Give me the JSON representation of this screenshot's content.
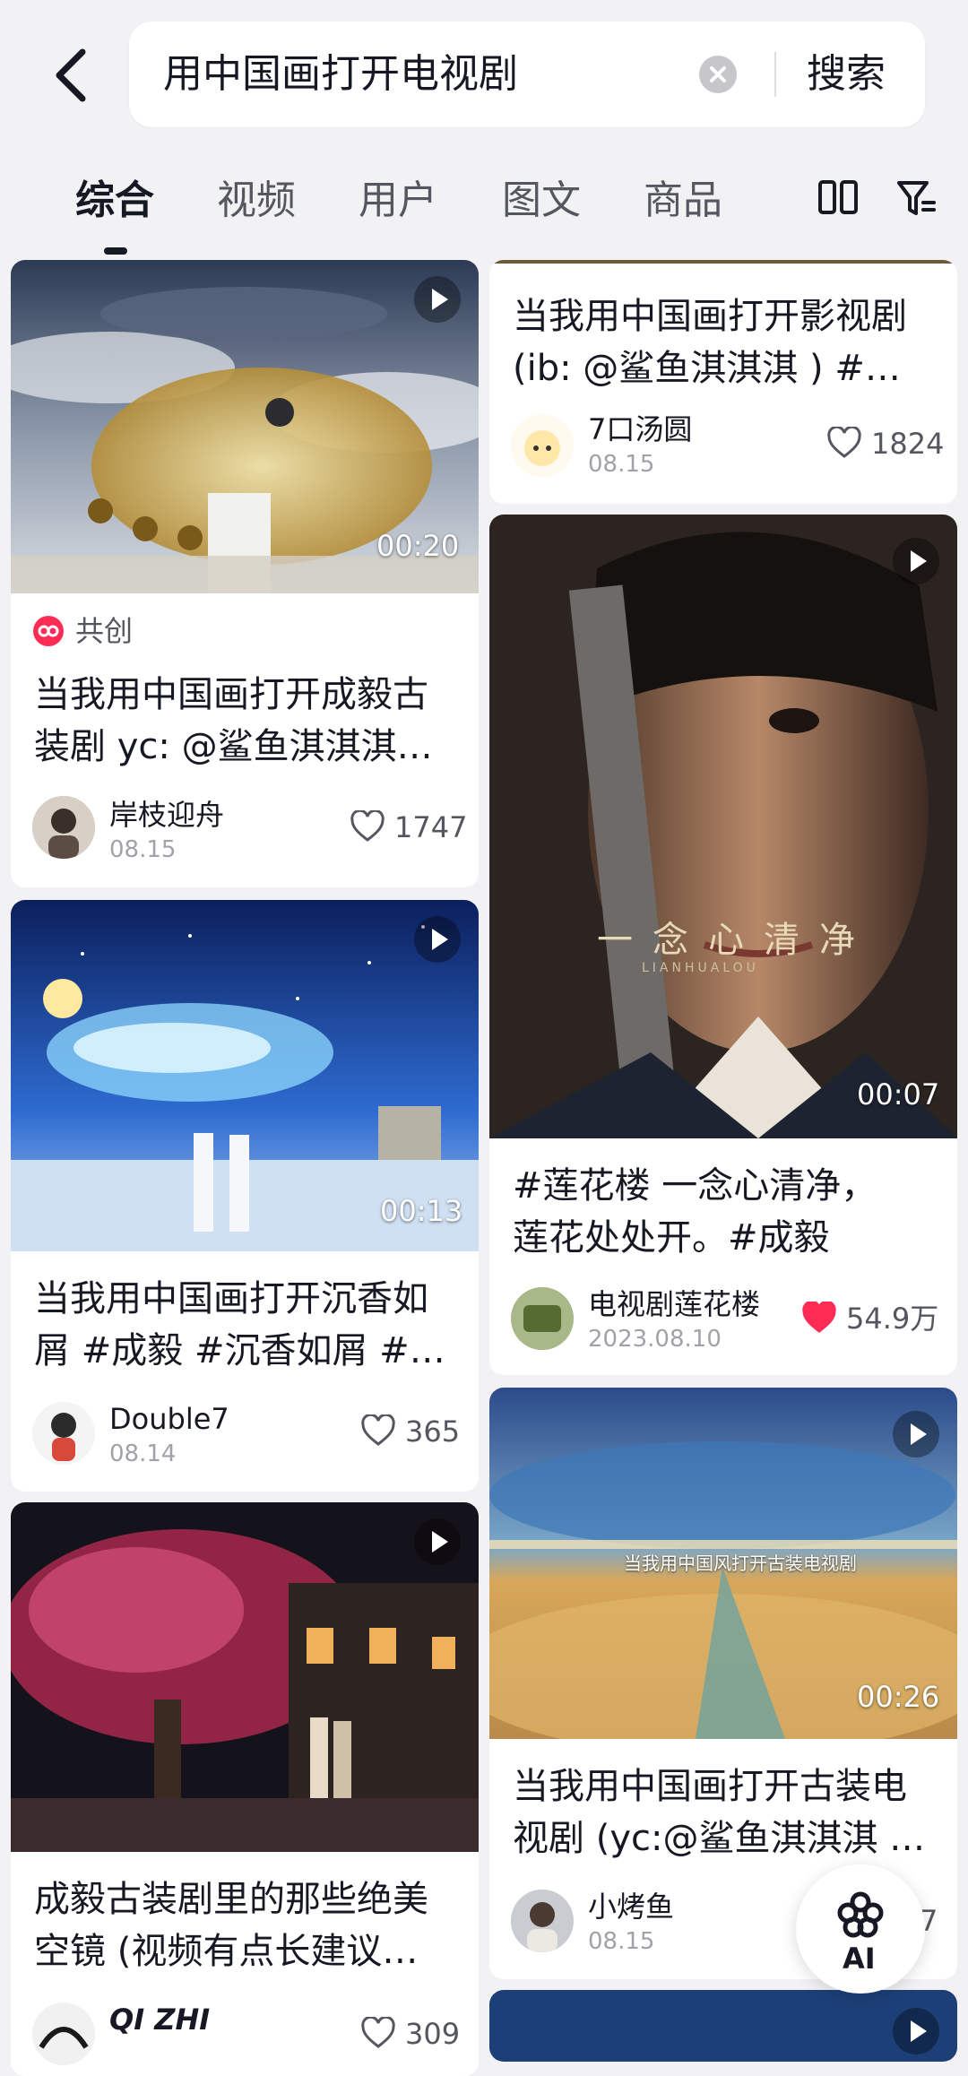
{
  "search": {
    "query": "用中国画打开电视剧",
    "button_label": "搜索"
  },
  "tabs": [
    {
      "label": "综合",
      "active": true
    },
    {
      "label": "视频",
      "active": false
    },
    {
      "label": "用户",
      "active": false
    },
    {
      "label": "图文",
      "active": false
    },
    {
      "label": "商品",
      "active": false
    }
  ],
  "toolbar_icons": [
    "layout-toggle-icon",
    "filter-icon"
  ],
  "cards": [
    {
      "column": "left",
      "tag": "共创",
      "duration": "00:20",
      "title_line1": "当我用中国画打开成毅古",
      "title_line2": "装剧  yc: @鲨鱼淇淇淇…",
      "author": "岸枝迎舟",
      "date": "08.15",
      "likes": "1747",
      "liked": false
    },
    {
      "column": "left",
      "duration": "00:13",
      "title_line1": "当我用中国画打开沉香如",
      "title_line2": "屑 #成毅 #沉香如屑 #…",
      "author": "Double7",
      "date": "08.14",
      "likes": "365",
      "liked": false
    },
    {
      "column": "left",
      "title_line1": "成毅古装剧里的那些绝美",
      "title_line2": "空镜 (视频有点长建议…",
      "author": "QI ZHI",
      "likes": "309",
      "liked": false
    },
    {
      "column": "right",
      "title_line1": "当我用中国画打开影视剧",
      "title_line2": "(ib: @鲨鱼淇淇淇 ) #…",
      "author": "7口汤圆",
      "date": "08.15",
      "likes": "1824",
      "liked": false
    },
    {
      "column": "right",
      "duration": "00:07",
      "overlay_text": "一念心清净",
      "overlay_sub": "LIANHUALOU",
      "title_line1": "#莲花楼   一念心清净，",
      "title_line2": "莲花处处开。#成毅",
      "author": "电视剧莲花楼",
      "date": "2023.08.10",
      "likes": "54.9万",
      "liked": true
    },
    {
      "column": "right",
      "duration": "00:26",
      "overlay_text": "当我用中国风打开古装电视剧",
      "title_line1": "当我用中国画打开古装电",
      "title_line2": "视剧 (yc:@鲨鱼淇淇淇 …",
      "author": "小烤鱼",
      "date": "08.15",
      "likes": "7",
      "liked": false
    }
  ],
  "ai_button": {
    "label": "AI"
  },
  "colors": {
    "background": "#f2f2f4",
    "heart_liked": "#fe2c55",
    "text": "#161823"
  }
}
